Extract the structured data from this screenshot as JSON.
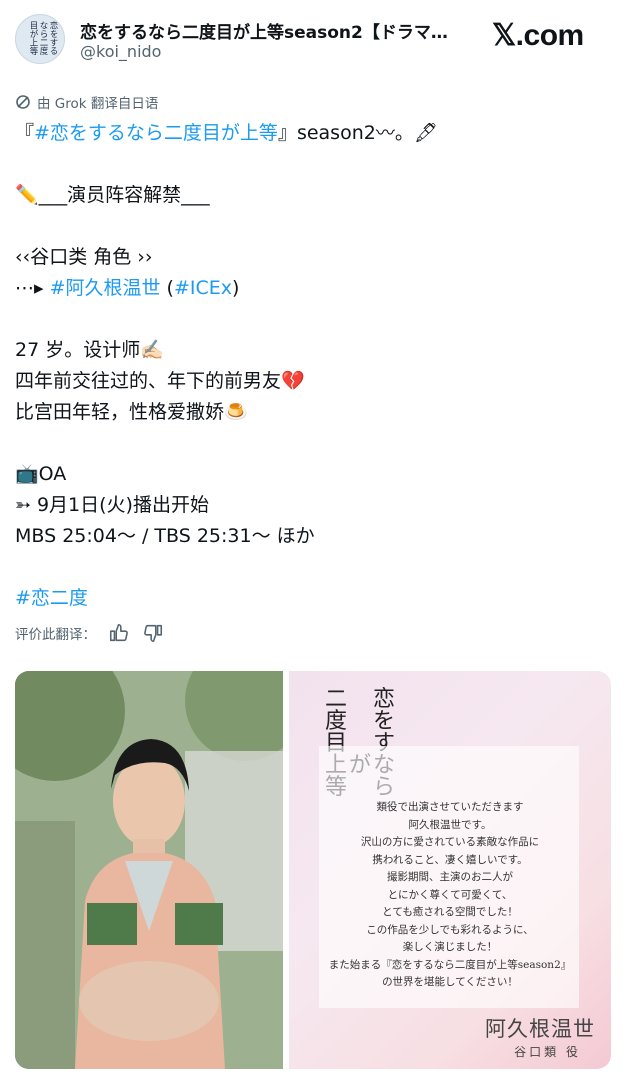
{
  "header": {
    "display_name": "恋をするなら二度目が上等season2【ドラマ…",
    "handle": "@koi_nido",
    "brand": "𝕏.com",
    "avatar_text": "恋をするなら二度目が上等"
  },
  "translation_note": "由 Grok 翻译自日语",
  "tweet_lines": [
    {
      "parts": [
        {
          "t": "『",
          "link": false
        },
        {
          "t": "#恋をするなら二度目が上等",
          "link": true
        },
        {
          "t": "』season2〰。🖋",
          "link": false
        }
      ]
    },
    {
      "parts": []
    },
    {
      "parts": [
        {
          "t": "✏️___演员阵容解禁___",
          "link": false
        }
      ]
    },
    {
      "parts": []
    },
    {
      "parts": [
        {
          "t": "‹‹谷口类 角色 ››",
          "link": false
        }
      ]
    },
    {
      "parts": [
        {
          "t": "⋯▸ ",
          "link": false
        },
        {
          "t": "#阿久根温世",
          "link": true
        },
        {
          "t": " (",
          "link": false
        },
        {
          "t": "#ICEx",
          "link": true
        },
        {
          "t": ")",
          "link": false
        }
      ]
    },
    {
      "parts": []
    },
    {
      "parts": [
        {
          "t": "27 岁。设计师✍🏻",
          "link": false
        }
      ]
    },
    {
      "parts": [
        {
          "t": "四年前交往过的、年下的前男友💔",
          "link": false
        }
      ]
    },
    {
      "parts": [
        {
          "t": "比宫田年轻，性格爱撒娇🍮",
          "link": false
        }
      ]
    },
    {
      "parts": []
    },
    {
      "parts": [
        {
          "t": "📺OA",
          "link": false
        }
      ]
    },
    {
      "parts": [
        {
          "t": "➳ 9月1日(火)播出开始",
          "link": false
        }
      ]
    },
    {
      "parts": [
        {
          "t": "MBS 25:04～ / TBS  25:31～ ほか",
          "link": false
        }
      ]
    },
    {
      "parts": []
    },
    {
      "parts": [
        {
          "t": "#恋二度",
          "link": true
        }
      ]
    }
  ],
  "rate": {
    "label": "评价此翻译：",
    "thumbs_up_icon": "thumbs-up-icon",
    "thumbs_down_icon": "thumbs-down-icon"
  },
  "poster": {
    "title_chars": [
      "恋",
      "を",
      "す",
      "な",
      "ら",
      "二",
      "度",
      "目",
      "が",
      "上",
      "等"
    ],
    "letter_lines": [
      "類役で出演させていただきます",
      "阿久根温世です。",
      "沢山の方に愛されている素敵な作品に",
      "携われること、凄く嬉しいです。",
      "撮影期間、主演のお二人が",
      "とにかく尊くて可愛くて、",
      "とても癒される空間でした！",
      "この作品を少しでも彩れるように、",
      "楽しく演じました！",
      "また始まる『恋をするなら二度目が上等season2』",
      "の世界を堪能してください！"
    ],
    "signature_name": "阿久根温世",
    "signature_role": "谷口類 役"
  },
  "colors": {
    "link": "#1d9bf0",
    "text": "#0f1419",
    "secondary": "#536471"
  }
}
